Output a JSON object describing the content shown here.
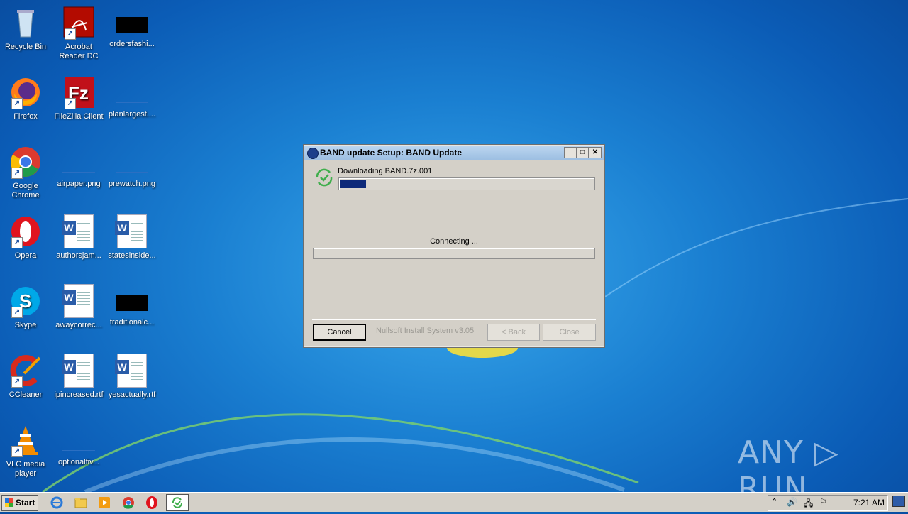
{
  "desktop": {
    "icons": [
      {
        "label": "Recycle Bin"
      },
      {
        "label": "Acrobat Reader DC"
      },
      {
        "label": "ordersfashi..."
      },
      {
        "label": "Firefox"
      },
      {
        "label": "FileZilla Client"
      },
      {
        "label": "planlargest...."
      },
      {
        "label": "Google Chrome"
      },
      {
        "label": "airpaper.png"
      },
      {
        "label": "prewatch.png"
      },
      {
        "label": "Opera"
      },
      {
        "label": "authorsjam..."
      },
      {
        "label": "statesinside..."
      },
      {
        "label": "Skype"
      },
      {
        "label": "awaycorrec..."
      },
      {
        "label": "traditionalc..."
      },
      {
        "label": "CCleaner"
      },
      {
        "label": "ipincreased.rtf"
      },
      {
        "label": "yesactually.rtf"
      },
      {
        "label": "VLC media player"
      },
      {
        "label": "optionalfiv..."
      }
    ]
  },
  "dialog": {
    "title": "BAND update Setup: BAND Update",
    "status_text": "Downloading BAND.7z.001",
    "download_progress": 0.1,
    "connecting_text": "Connecting ...",
    "secondary_progress": 0,
    "branding": "Nullsoft Install System v3.05",
    "cancel_label": "Cancel",
    "back_label": "< Back",
    "close_label": "Close",
    "title_buttons": {
      "minimize": "_",
      "maximize": "□",
      "close": "✕"
    }
  },
  "taskbar": {
    "start_label": "Start",
    "clock": "7:21 AM",
    "apps": [
      "internet-explorer-icon",
      "explorer-icon",
      "media-player-icon",
      "chrome-icon",
      "opera-icon",
      "installer-icon"
    ]
  },
  "watermark": "ANY ▷ RUN",
  "colors": {
    "desktop": "#1a7fd1",
    "dialog_bg": "#d4d0c8",
    "progress": "#0e2a7a",
    "title_bar": "#9dbfe2"
  }
}
